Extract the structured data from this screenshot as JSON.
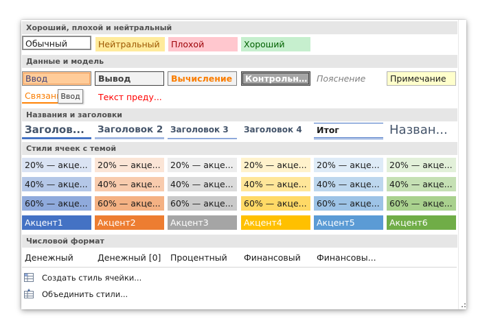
{
  "sections": {
    "good_bad": "Хороший, плохой и нейтральный",
    "data_model": "Данные и модель",
    "titles": "Названия и заголовки",
    "themed": "Стили ячеек с темой",
    "number": "Числовой формат"
  },
  "good_bad": {
    "normal": "Обычный",
    "neutral": "Нейтральный",
    "bad": "Плохой",
    "good": "Хороший"
  },
  "data_model": {
    "input": "Ввод",
    "output": "Вывод",
    "calc": "Вычисление",
    "check": "Контрольна...",
    "explain": "Пояснение",
    "note": "Примечание",
    "linked": "Связанная",
    "warning": "Текст преду...",
    "tooltip": "Ввод"
  },
  "headings": {
    "h1": "Заголов...",
    "h2": "Заголовок 2",
    "h3": "Заголовок 3",
    "h4": "Заголовок 4",
    "total": "Итог",
    "title": "Назван..."
  },
  "themed": {
    "row20": [
      "20% — акце...",
      "20% — акце...",
      "20% — акце...",
      "20% — акце...",
      "20% — акце...",
      "20% — акце..."
    ],
    "row40": [
      "40% — акце...",
      "40% — акце...",
      "40% — акце...",
      "40% — акце...",
      "40% — акце...",
      "40% — акце..."
    ],
    "row60": [
      "60% — акце...",
      "60% — акце...",
      "60% — акце...",
      "60% — акце...",
      "60% — акце...",
      "60% — акце..."
    ],
    "accents": [
      "Акцент1",
      "Акцент2",
      "Акцент3",
      "Акцент4",
      "Акцент5",
      "Акцент6"
    ],
    "colors20": [
      "#dae3f3",
      "#fbe5d6",
      "#ededed",
      "#fff2cc",
      "#deebf7",
      "#e2f0d9"
    ],
    "colors40": [
      "#b4c7e7",
      "#f8cbad",
      "#dbdbdb",
      "#ffe699",
      "#bdd7ee",
      "#c5e0b4"
    ],
    "colors60": [
      "#8faadc",
      "#f4b183",
      "#c9c9c9",
      "#ffd966",
      "#9dc3e6",
      "#a9d18e"
    ],
    "colorsAccent": [
      "#4472c4",
      "#ed7d31",
      "#a5a5a5",
      "#ffc000",
      "#5b9bd5",
      "#70ad47"
    ]
  },
  "number": {
    "items": [
      "Денежный",
      "Денежный [0]",
      "Процентный",
      "Финансовый",
      "Финансовы..."
    ]
  },
  "commands": {
    "new_style": "Создать стиль ячейки...",
    "merge_styles": "Объединить стили..."
  }
}
